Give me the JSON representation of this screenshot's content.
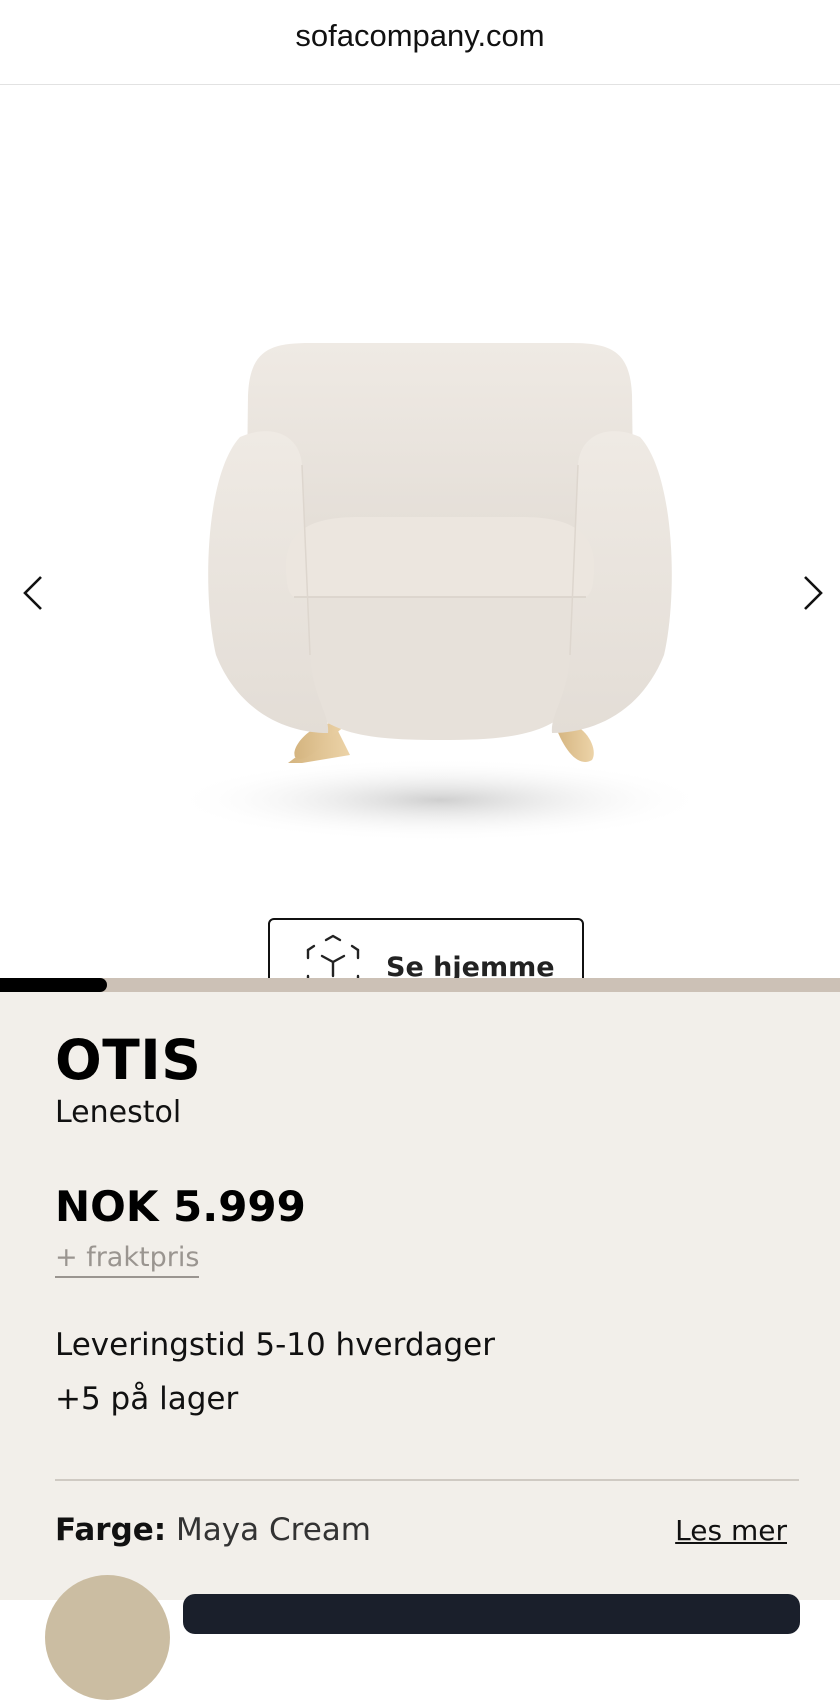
{
  "browser": {
    "url": "sofacompany.com"
  },
  "gallery": {
    "prev_icon": "chevron-left-icon",
    "next_icon": "chevron-right-icon",
    "image_alt": "Otis lenestol",
    "ar_button": {
      "icon": "ar-cube-icon",
      "label": "Se hjemme"
    },
    "progress": 0.127
  },
  "product": {
    "name": "OTIS",
    "type": "Lenestol",
    "price": "NOK 5.999",
    "freight_link": "+ fraktpris",
    "delivery": "Leveringstid 5-10 hverdager",
    "stock": "+5 på lager",
    "color": {
      "label": "Farge:",
      "value": "Maya Cream",
      "read_more": "Les mer"
    }
  },
  "colors": {
    "chair_fabric": "#ece6e0",
    "leg_wood": "#e2c79a",
    "swatch": "#cbbda2",
    "info_bg": "#f2efea",
    "progress_track": "#ccc1b6"
  }
}
